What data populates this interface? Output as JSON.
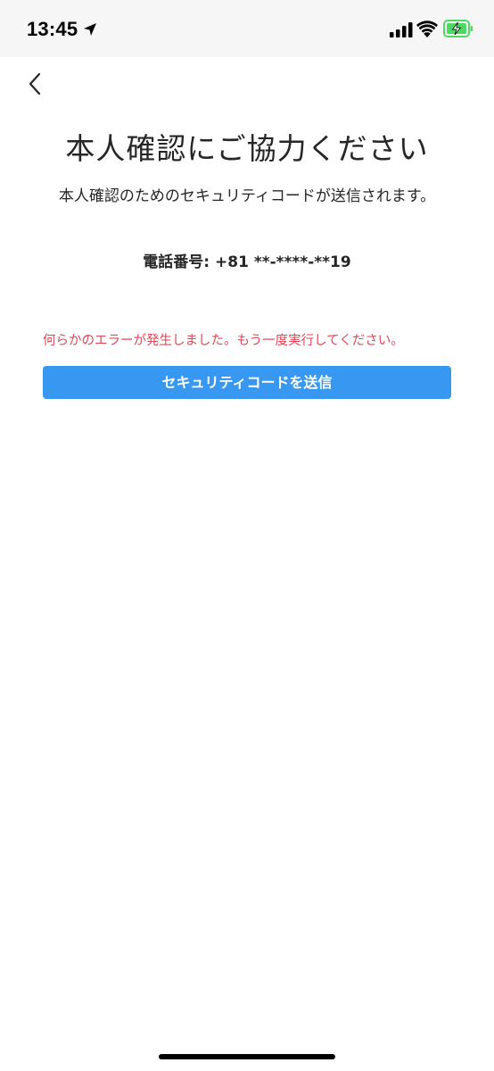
{
  "status_bar": {
    "time": "13:45",
    "icons": [
      "location-arrow-icon",
      "cellular-signal-icon",
      "wifi-icon",
      "battery-charging-icon"
    ],
    "battery_color": "#4cd964"
  },
  "nav": {
    "back_icon": "chevron-left-icon"
  },
  "main": {
    "title": "本人確認にご協力ください",
    "subtitle": "本人確認のためのセキュリティコードが送信されます。",
    "phone_label": "電話番号: +81 **-****-**19",
    "error_message": "何らかのエラーが発生しました。もう一度実行してください。",
    "send_button_label": "セキュリティコードを送信"
  },
  "colors": {
    "accent": "#3897f0",
    "error": "#e04856",
    "status_bar_bg": "#f6f6f6",
    "text": "#262626"
  }
}
